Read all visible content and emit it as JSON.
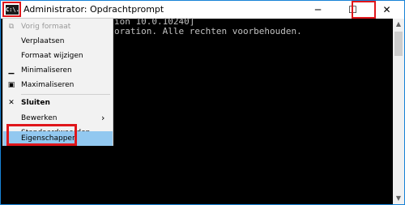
{
  "window": {
    "title": "Administrator: Opdrachtprompt",
    "icon_label": "C:\\.",
    "buttons": {
      "minimize": "─",
      "maximize": "☐",
      "close": "✕"
    }
  },
  "console": {
    "lines": [
      "ion 10.0.10240]",
      "oration. Alle rechten voorbehouden."
    ]
  },
  "scrollbar": {
    "up": "▲",
    "down": "▼"
  },
  "menu": {
    "items": [
      {
        "glyph": "⧉",
        "label": "Vorig formaat",
        "disabled": true
      },
      {
        "glyph": "",
        "label": "Verplaatsen"
      },
      {
        "glyph": "",
        "label": "Formaat wijzigen"
      },
      {
        "glyph": "▁",
        "label": "Minimaliseren"
      },
      {
        "glyph": "▣",
        "label": "Maximaliseren"
      },
      {
        "glyph": "✕",
        "label": "Sluiten",
        "bold": true
      },
      {
        "glyph": "",
        "label": "Bewerken",
        "arrow": "›"
      },
      {
        "glyph": "",
        "label": "Standaardwaarden"
      },
      {
        "glyph": "",
        "label": "Eigenschappen",
        "selected": true
      }
    ]
  },
  "colors": {
    "highlight_border": "#e0161b",
    "selection": "#92c8f0",
    "console_bg": "#000000"
  }
}
